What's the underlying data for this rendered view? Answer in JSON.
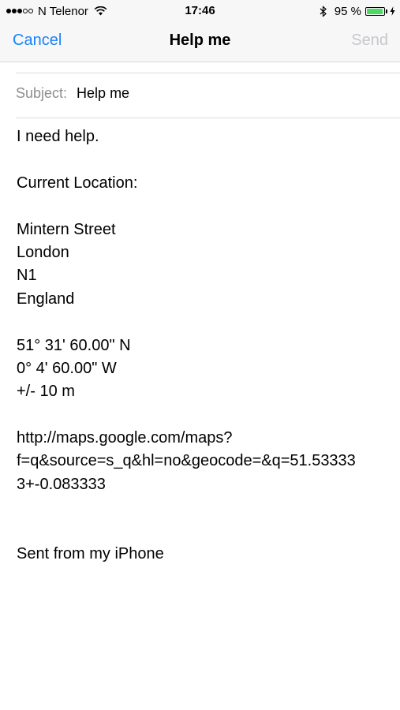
{
  "status_bar": {
    "carrier": "N Telenor",
    "time": "17:46",
    "battery_percent": "95 %",
    "battery_level": 0.95,
    "signal_bars_filled": 3,
    "signal_bars_total": 5,
    "battery_color": "#4cd964"
  },
  "nav": {
    "cancel_label": "Cancel",
    "title": "Help me",
    "send_label": "Send",
    "accent_color": "#1a82f7",
    "disabled_color": "#c7c7cc"
  },
  "compose": {
    "subject_label": "Subject:",
    "subject_value": "Help me"
  },
  "body": {
    "intro": "I need help.",
    "location_heading": "Current Location:",
    "address": {
      "street": "Mintern Street",
      "city": "London",
      "postcode": "N1",
      "country": "England"
    },
    "coordinates": {
      "latitude": "51° 31' 60.00\" N",
      "longitude": "0° 4' 60.00\" W",
      "accuracy": "+/- 10 m"
    },
    "map_link": {
      "line1": "http://maps.google.com/maps?",
      "line2": "f=q&source=s_q&hl=no&geocode=&q=51.53333",
      "line3": "3+-0.083333"
    },
    "signature": "Sent from my iPhone"
  }
}
